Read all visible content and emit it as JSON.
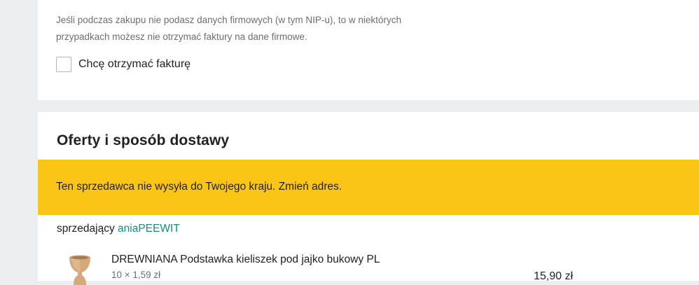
{
  "invoice": {
    "note": "Jeśli podczas zakupu nie podasz danych firmowych (w tym NIP-u), to w niektórych przypadkach możesz nie otrzymać faktury na dane firmowe.",
    "checkbox_label": "Chcę otrzymać fakturę",
    "checkbox_checked": false
  },
  "offers": {
    "heading": "Oferty i sposób dostawy",
    "warning": "Ten sprzedawca nie wysyła do Twojego kraju. Zmień adres.",
    "seller_prefix": "sprzedający",
    "seller_name": "aniaPEEWIT",
    "product": {
      "name": "DREWNIANA Podstawka kieliszek pod jajko bukowy PL",
      "quantity_line": "10 × 1,59 zł",
      "price": "15,90 zł",
      "image_icon": "wooden-egg-cup-image"
    }
  },
  "colors": {
    "page_background": "#eceff2",
    "card_background": "#ffffff",
    "warning_background": "#fac515",
    "seller_link": "#178d7f"
  }
}
